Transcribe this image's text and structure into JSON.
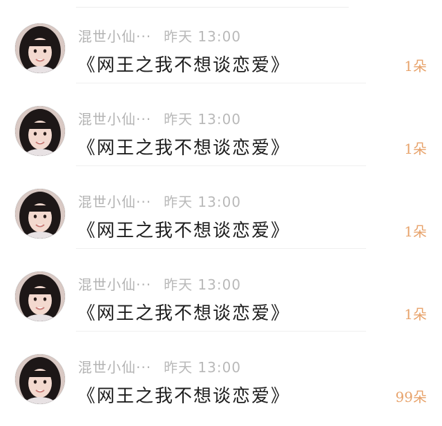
{
  "colors": {
    "meta_text": "#b5b5b5",
    "title_text": "#1e1e1e",
    "flower_count": "#e7a26a",
    "divider": "#efefef"
  },
  "rows": [
    {
      "username": "混世小仙···",
      "time": "昨天 13:00",
      "title": "《网王之我不想谈恋爱》",
      "flowers": "1朵",
      "avatar_icon": "girl-portrait-avatar"
    },
    {
      "username": "混世小仙···",
      "time": "昨天 13:00",
      "title": "《网王之我不想谈恋爱》",
      "flowers": "1朵",
      "avatar_icon": "girl-portrait-avatar"
    },
    {
      "username": "混世小仙···",
      "time": "昨天 13:00",
      "title": "《网王之我不想谈恋爱》",
      "flowers": "1朵",
      "avatar_icon": "girl-portrait-avatar"
    },
    {
      "username": "混世小仙···",
      "time": "昨天 13:00",
      "title": "《网王之我不想谈恋爱》",
      "flowers": "1朵",
      "avatar_icon": "girl-portrait-avatar"
    },
    {
      "username": "混世小仙···",
      "time": "昨天 13:00",
      "title": "《网王之我不想谈恋爱》",
      "flowers": "99朵",
      "avatar_icon": "girl-portrait-avatar"
    }
  ]
}
